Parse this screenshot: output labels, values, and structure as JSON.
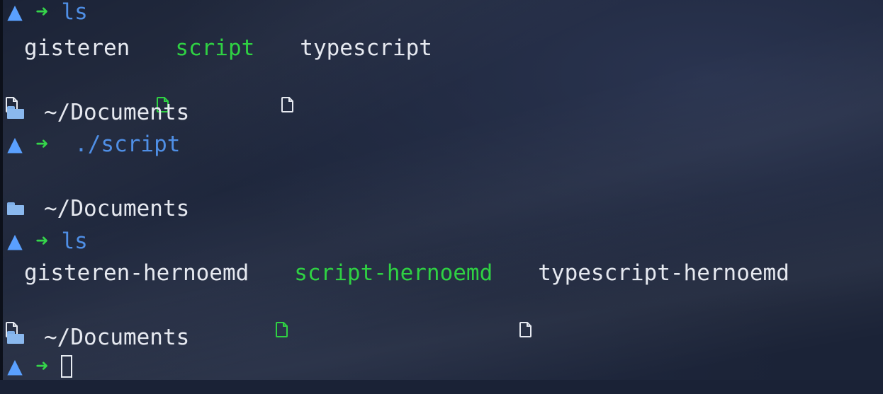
{
  "terminal": {
    "lines": [
      {
        "type": "prompt",
        "command": "ls"
      },
      {
        "type": "files",
        "files": [
          {
            "name": "gisteren",
            "color": "#e6e9f0"
          },
          {
            "name": "script",
            "color": "#2fd143"
          },
          {
            "name": "typescript",
            "color": "#e6e9f0"
          }
        ]
      },
      {
        "type": "dir",
        "path": "~/Documents"
      },
      {
        "type": "prompt",
        "command": " ./script"
      },
      {
        "type": "dir",
        "path": "~/Documents"
      },
      {
        "type": "prompt",
        "command": "ls"
      },
      {
        "type": "files",
        "files": [
          {
            "name": "gisteren-hernoemd",
            "color": "#e6e9f0"
          },
          {
            "name": "script-hernoemd",
            "color": "#2fd143"
          },
          {
            "name": "typescript-hernoemd",
            "color": "#e6e9f0"
          }
        ]
      },
      {
        "type": "dir",
        "path": "~/Documents"
      },
      {
        "type": "prompt-cursor"
      }
    ],
    "icons": {
      "prompt": "arch-logo-icon",
      "arrow": "arrow-right-icon",
      "folder": "folder-open-icon",
      "file": "file-icon"
    },
    "colors": {
      "background": "#1b2337",
      "prompt": "#5aa0ff",
      "arrow": "#35d64a",
      "command": "#4f8fe6",
      "executable": "#2fd143",
      "text": "#e6e9f0"
    }
  }
}
